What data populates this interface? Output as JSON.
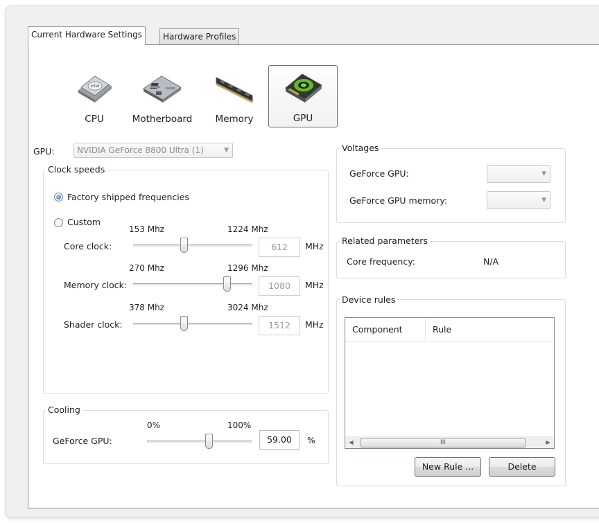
{
  "tabs": [
    {
      "label": "Current Hardware Settings",
      "active": true
    },
    {
      "label": "Hardware Profiles",
      "active": false
    }
  ],
  "hardware": [
    {
      "label": "CPU",
      "icon": "cpu-chip-icon"
    },
    {
      "label": "Motherboard",
      "icon": "motherboard-icon"
    },
    {
      "label": "Memory",
      "icon": "memory-module-icon"
    },
    {
      "label": "GPU",
      "icon": "gpu-card-icon",
      "selected": true
    }
  ],
  "gpu_select": {
    "label": "GPU:",
    "value": "NVIDIA GeForce 8800 Ultra (1)"
  },
  "clock": {
    "title": "Clock speeds",
    "factory_label": "Factory shipped frequencies",
    "custom_label": "Custom",
    "selected_mode": "factory",
    "unit": "MHz",
    "rows": [
      {
        "label": "Core clock:",
        "min": "153 Mhz",
        "max": "1224 Mhz",
        "value": "612",
        "fraction": 0.43
      },
      {
        "label": "Memory clock:",
        "min": "270 Mhz",
        "max": "1296 Mhz",
        "value": "1080",
        "fraction": 0.79
      },
      {
        "label": "Shader clock:",
        "min": "378 Mhz",
        "max": "3024 Mhz",
        "value": "1512",
        "fraction": 0.43
      }
    ]
  },
  "cooling": {
    "title": "Cooling",
    "label": "GeForce GPU:",
    "min": "0%",
    "max": "100%",
    "value": "59.00",
    "unit": "%",
    "fraction": 0.59
  },
  "voltages": {
    "title": "Voltages",
    "rows": [
      {
        "label": "GeForce GPU:",
        "value": ""
      },
      {
        "label": "GeForce GPU memory:",
        "value": ""
      }
    ]
  },
  "related": {
    "title": "Related parameters",
    "label": "Core frequency:",
    "value": "N/A"
  },
  "device_rules": {
    "title": "Device rules",
    "columns": [
      "Component",
      "Rule"
    ],
    "rows": [],
    "scroll_thumb": "III",
    "new_rule": "New Rule ...",
    "delete": "Delete"
  }
}
